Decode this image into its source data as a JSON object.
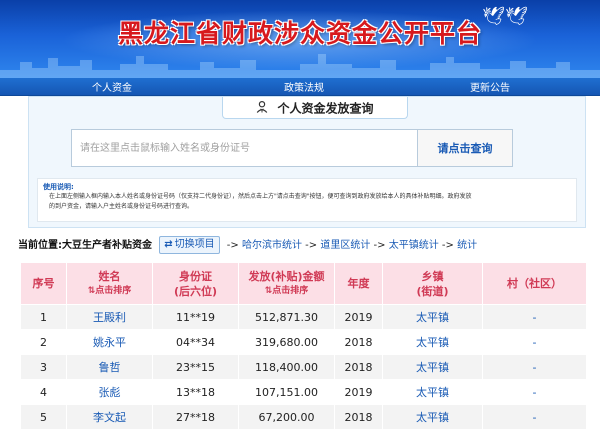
{
  "banner": {
    "title": "黑龙江省财政涉众资金公开平台"
  },
  "nav": {
    "items": [
      "个人资金",
      "政策法规",
      "更新公告"
    ]
  },
  "query": {
    "tab_label": "个人资金发放查询",
    "search_placeholder": "请在这里点击鼠标输入姓名或身份证号",
    "search_button": "请点击查询"
  },
  "instructions": {
    "title": "使用说明:",
    "line1": "在上面左侧输入框内输入本人姓名或身份证号码（仅支持二代身份证），然后点击上方\"请点击查询\"按钮，便可查询到政府发放给本人的具体补贴明细。政府发放",
    "line2": "的到户资金，请输入户主姓名或身份证号码进行查询。"
  },
  "breadcrumb": {
    "location": "当前位置:",
    "current": "大豆生产者补贴资金",
    "switch_button": "切换项目",
    "sep": "->",
    "links": [
      "哈尔滨市统计",
      "道里区统计",
      "太平镇统计",
      "统计"
    ]
  },
  "table": {
    "headers": {
      "index": "序号",
      "name": "姓名",
      "name_sort": "⇅点击排序",
      "id_line1": "身份证",
      "id_line2": "(后六位)",
      "amount": "发放(补贴)金额",
      "amount_sort": "⇅点击排序",
      "year": "年度",
      "town_line1": "乡镇",
      "town_line2": "(街道)",
      "village": "村（社区）"
    },
    "rows": [
      {
        "index": "1",
        "name": "王殿利",
        "id": "11**19",
        "amount": "512,871.30",
        "year": "2019",
        "town": "太平镇",
        "village": "-"
      },
      {
        "index": "2",
        "name": "姚永平",
        "id": "04**34",
        "amount": "319,680.00",
        "year": "2018",
        "town": "太平镇",
        "village": "-"
      },
      {
        "index": "3",
        "name": "鲁哲",
        "id": "23**15",
        "amount": "118,400.00",
        "year": "2018",
        "town": "太平镇",
        "village": "-"
      },
      {
        "index": "4",
        "name": "张彪",
        "id": "13**18",
        "amount": "107,151.00",
        "year": "2019",
        "town": "太平镇",
        "village": "-"
      },
      {
        "index": "5",
        "name": "李文起",
        "id": "27**18",
        "amount": "67,200.00",
        "year": "2018",
        "town": "太平镇",
        "village": "-"
      }
    ]
  },
  "colors": {
    "banner_blue": "#1a62d8",
    "title_red": "#d7191d",
    "header_pink": "#fcdfe6",
    "header_text": "#d03a55",
    "link_blue": "#1a5bb5"
  },
  "icons": {
    "tab": "person-yen-icon",
    "switch": "swap-icon",
    "sort": "sort-arrows-icon",
    "banner": "dove-icon"
  }
}
